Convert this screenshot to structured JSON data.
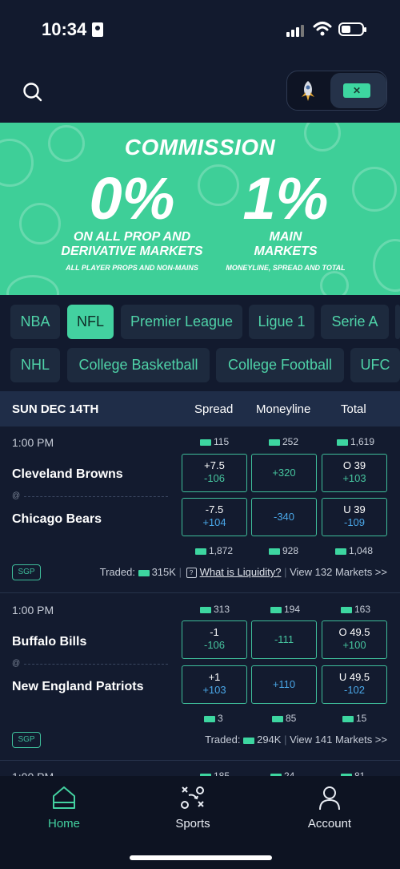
{
  "status_bar": {
    "time": "10:34"
  },
  "banner": {
    "title": "COMMISSION",
    "left_big": "0%",
    "left_sub1": "ON ALL PROP AND",
    "left_sub2": "DERIVATIVE MARKETS",
    "left_small": "ALL PLAYER PROPS AND NON-MAINS",
    "right_big": "1%",
    "right_sub1": "MAIN",
    "right_sub2": "MARKETS",
    "right_small": "MONEYLINE, SPREAD AND TOTAL",
    "bg_color": "#3ecf98"
  },
  "leagues_row1": [
    "NBA",
    "NFL",
    "Premier League",
    "Ligue 1",
    "Serie A"
  ],
  "leagues_row2": [
    "NHL",
    "College Basketball",
    "College Football",
    "UFC"
  ],
  "active_league": "NFL",
  "date_header": {
    "date": "SUN DEC 14TH",
    "col_spread": "Spread",
    "col_moneyline": "Moneyline",
    "col_total": "Total"
  },
  "games": [
    {
      "time": "1:00 PM",
      "away_team": "Cleveland Browns",
      "home_team": "Chicago Bears",
      "at": "@",
      "away_volumes": [
        "115",
        "252",
        "1,619"
      ],
      "home_volumes": [
        "1,872",
        "928",
        "1,048"
      ],
      "away_spread_line": "+7.5",
      "away_spread_odds": "-106",
      "away_moneyline": "+320",
      "away_total_line": "O 39",
      "away_total_odds": "+103",
      "home_spread_line": "-7.5",
      "home_spread_odds": "+104",
      "home_moneyline": "-340",
      "home_total_line": "U 39",
      "home_total_odds": "-109",
      "sgp": "SGP",
      "traded_label": "Traded:",
      "traded": "315K",
      "liquidity": "What is Liquidity?",
      "view_markets": "View 132 Markets >>"
    },
    {
      "time": "1:00 PM",
      "away_team": "Buffalo Bills",
      "home_team": "New England Patriots",
      "at": "@",
      "away_volumes": [
        "313",
        "194",
        "163"
      ],
      "home_volumes": [
        "3",
        "85",
        "15"
      ],
      "away_spread_line": "-1",
      "away_spread_odds": "-106",
      "away_moneyline": "-111",
      "away_total_line": "O 49.5",
      "away_total_odds": "+100",
      "home_spread_line": "+1",
      "home_spread_odds": "+103",
      "home_moneyline": "+110",
      "home_total_line": "U 49.5",
      "home_total_odds": "-102",
      "sgp": "SGP",
      "traded_label": "Traded:",
      "traded": "294K",
      "view_markets": "View 141 Markets >>"
    },
    {
      "time": "1:00 PM",
      "away_volumes": [
        "185",
        "24",
        "81"
      ]
    }
  ],
  "tabbar": {
    "home": "Home",
    "sports": "Sports",
    "account": "Account"
  },
  "colors": {
    "accent": "#43d1a0",
    "background": "#121a2e",
    "odds_green": "#46c49e",
    "odds_blue": "#4aa7e8"
  }
}
